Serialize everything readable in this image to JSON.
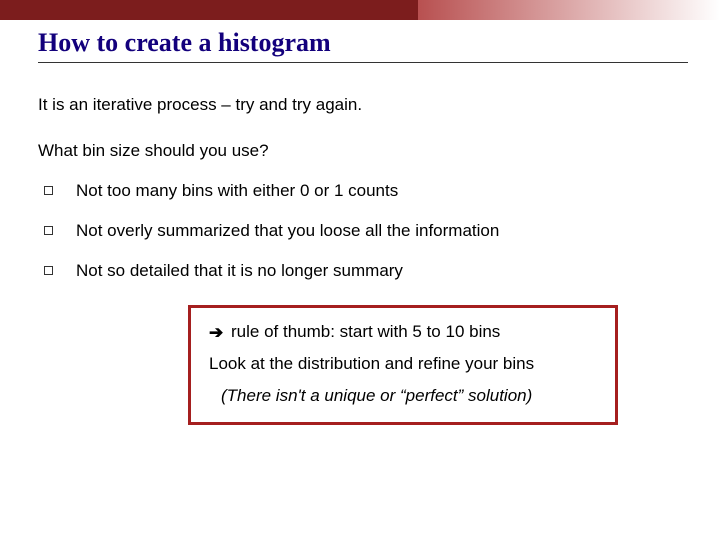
{
  "title": "How to create a histogram",
  "intro": "It is an iterative process – try and try again.",
  "question": "What bin size should you use?",
  "bullets": [
    "Not too many bins with either 0 or 1 counts",
    "Not overly summarized that you loose all the information",
    "Not so detailed that it is no longer summary"
  ],
  "box": {
    "arrow": "➔",
    "rule": "rule of thumb: start with 5 to 10 bins",
    "look": "Look at the distribution and refine your bins",
    "note": "(There isn't a unique or “perfect” solution)"
  }
}
